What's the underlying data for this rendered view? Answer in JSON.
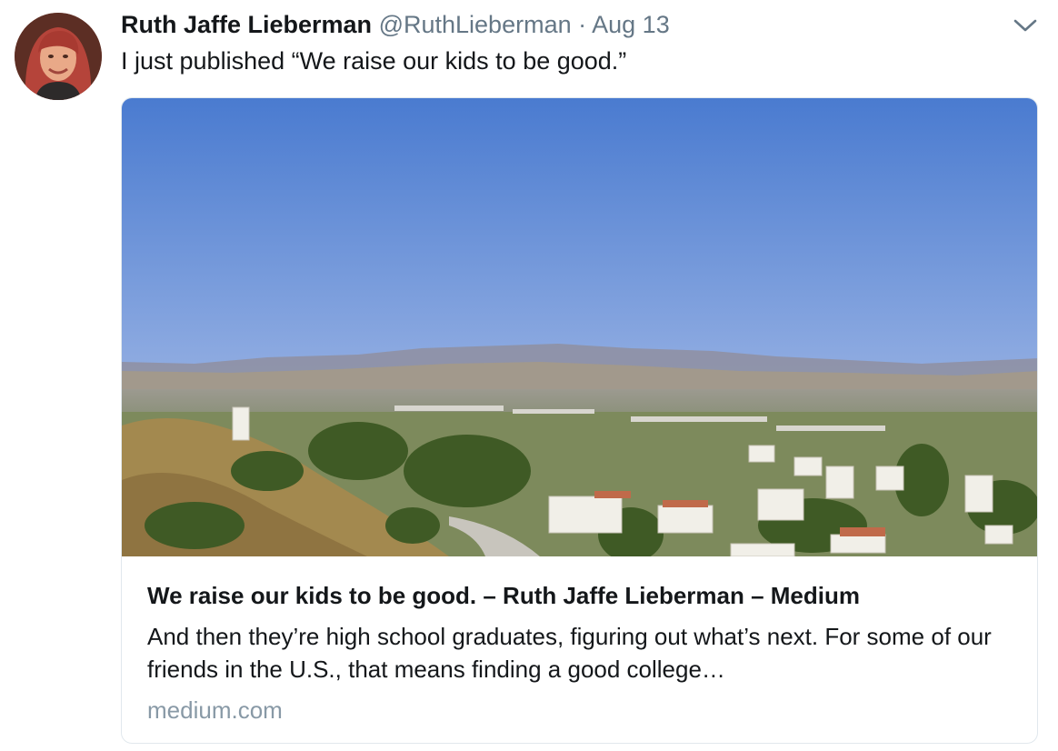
{
  "tweet": {
    "author_name": "Ruth Jaffe Lieberman",
    "handle": "@RuthLieberman",
    "separator": "·",
    "date": "Aug 13",
    "text": "I just published “We raise our kids to be good.”"
  },
  "card": {
    "title": "We raise our kids to be good. – Ruth Jaffe Lieberman – Medium",
    "description": "And then they’re high school graduates, figuring out what’s next. For some of our friends in the U.S., that means finding a good college…",
    "domain": "medium.com"
  },
  "icons": {
    "menu": "chevron-down-icon"
  },
  "colors": {
    "text_primary": "#14171a",
    "text_secondary": "#657786",
    "domain_text": "#8899a6",
    "card_border": "#e1e8ed"
  }
}
